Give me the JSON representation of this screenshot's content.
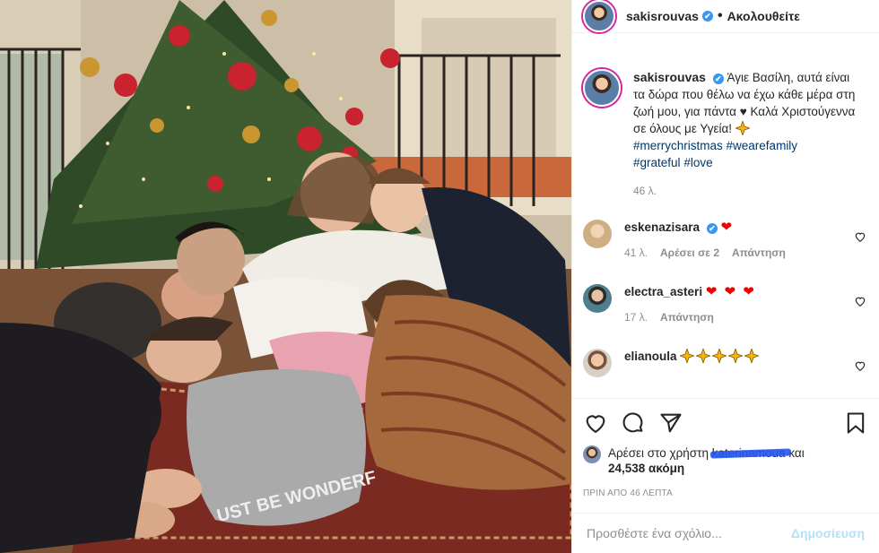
{
  "post": {
    "username": "sakisrouvas",
    "verified_mark": "✔",
    "follow_label": "Ακολουθείτε",
    "separator": "•"
  },
  "caption": {
    "username": "sakisrouvas",
    "text": "Άγιε Βασίλη, αυτά είναι τα δώρα που θέλω να έχω κάθε μέρα στη ζωή μου, για πάντα ♥ Καλά Χριστούγεννα σε όλους με Υγεία!",
    "hashtags": [
      "#merrychristmas",
      "#wearefamily",
      "#grateful",
      "#love"
    ],
    "time": "46 λ."
  },
  "comments": [
    {
      "username": "eskenazisara",
      "verified": true,
      "text": "❤",
      "time": "41 λ.",
      "likes": "Αρέσει σε 2",
      "reply": "Απάντηση",
      "avatar_color": "#d9b48a"
    },
    {
      "username": "electra_asteri",
      "verified": false,
      "text": "❤ ❤ ❤",
      "time": "17 λ.",
      "reply": "Απάντηση",
      "avatar_color": "#3f6b7c"
    },
    {
      "username": "elianoula",
      "verified": false,
      "text": "",
      "stars": 5,
      "avatar_color": "#c89a7b"
    }
  ],
  "likes": {
    "prefix": "Αρέσει στο χρήστη",
    "redacted_name": "katerinamoua",
    "and": "και",
    "count": "24,538 ακόμη"
  },
  "timestamp": "ΠΡΙΝ ΑΠΟ 46 ΛΕΠΤΑ",
  "add_comment": {
    "placeholder": "Προσθέστε ένα σχόλιο...",
    "post_label": "Δημοσίευση"
  },
  "photo": {
    "shirt_text": "UST BE WONDERF"
  },
  "colors": {
    "link": "#00376b",
    "verified": "#3897f0",
    "post_disabled": "#b2dffc",
    "heart": "#ed4956"
  }
}
